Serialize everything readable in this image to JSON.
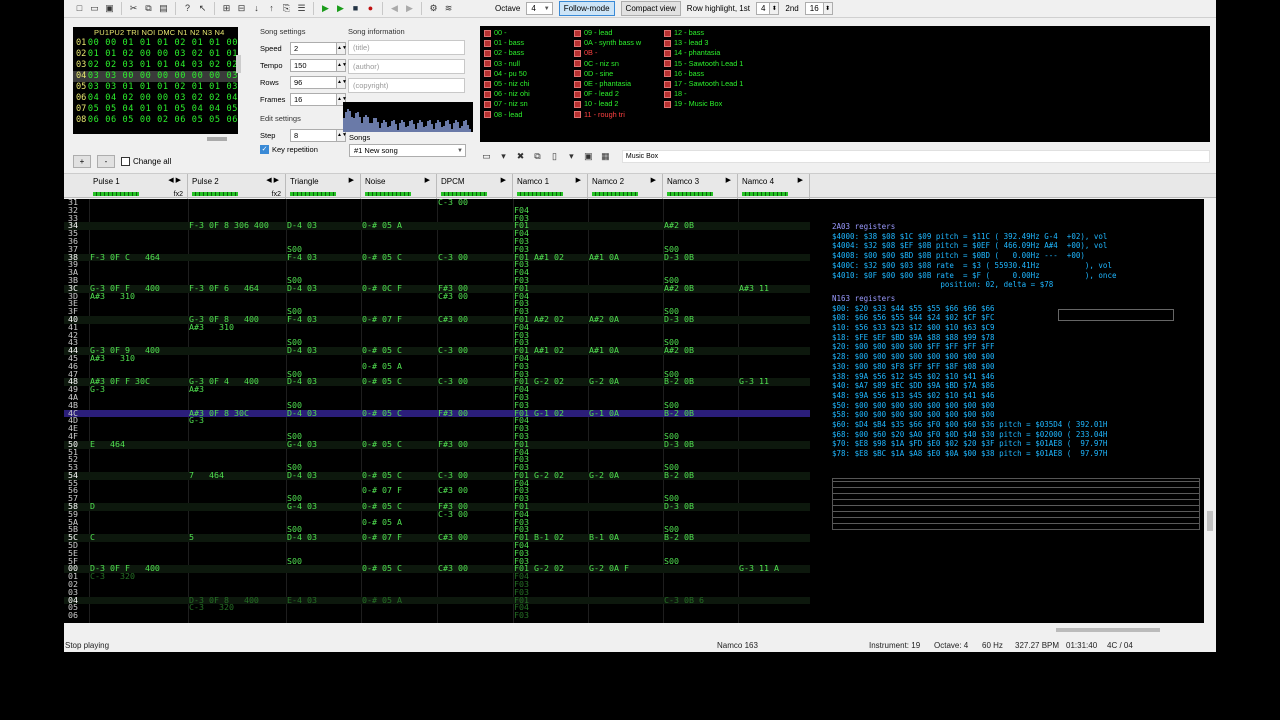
{
  "toolbar": {
    "octave_label": "Octave",
    "octave": "4",
    "follow": "Follow-mode",
    "compact": "Compact view",
    "rowhl_label": "Row highlight, 1st",
    "rowhl1": "4",
    "rowhl2_label": "2nd",
    "rowhl2": "16"
  },
  "frames": {
    "header": "PU1PU2 TRI NOI DMC N1  N2  N3  N4",
    "rows": [
      {
        "n": "01",
        "v": "00 00 01 01 01 02 01 01 00"
      },
      {
        "n": "02",
        "v": "01 01 02 00 00 03 02 01 01"
      },
      {
        "n": "03",
        "v": "02 02 03 01 01 04 03 02 02"
      },
      {
        "n": "04",
        "v": "03 03 00 00 00 00 00 00 03"
      },
      {
        "n": "05",
        "v": "03 03 01 01 01 02 01 01 03"
      },
      {
        "n": "06",
        "v": "04 04 02 00 00 03 02 02 04"
      },
      {
        "n": "07",
        "v": "05 05 04 01 01 05 04 04 05"
      },
      {
        "n": "08",
        "v": "06 06 05 00 02 06 05 05 06"
      }
    ]
  },
  "add_frame": "+",
  "remove_frame": "-",
  "change_all": "Change all",
  "song_settings": {
    "title": "Song settings",
    "speed_label": "Speed",
    "speed": "2",
    "tempo_label": "Tempo",
    "tempo": "150",
    "rows_label": "Rows",
    "rows": "96",
    "frames_label": "Frames",
    "frames": "16"
  },
  "edit_settings": {
    "title": "Edit settings",
    "step_label": "Step",
    "step": "8",
    "keyrep": "Key repetition"
  },
  "song_info": {
    "title": "Song information",
    "title_ph": "(title)",
    "author_ph": "(author)",
    "copyright_ph": "(copyright)"
  },
  "songs": {
    "label": "Songs",
    "selected": "#1 New song"
  },
  "instruments": {
    "col1": [
      "00 -",
      "01 - bass",
      "02 - bass",
      "03 - null",
      "04 - pu 50",
      "05 - niz chi",
      "06 - niz ohi",
      "07 - niz sn",
      "08 - lead"
    ],
    "col2": [
      "09 - lead",
      "0A - synth bass w",
      "0B -",
      "0C - niz sn",
      "0D - sine",
      "0E - phantasia",
      "0F - lead 2",
      "10 - lead 2",
      "11 - rough tri"
    ],
    "col3": [
      "12 - bass",
      "13 - lead 3",
      "14 - phantasia",
      "15 - Sawtooth Lead 1",
      "16 - bass",
      "17 - Sawtooth Lead 1",
      "18 -",
      "19 - Music Box"
    ],
    "name": "Music Box"
  },
  "channels": [
    {
      "name": "Pulse 1",
      "fx": "fx2"
    },
    {
      "name": "Pulse 2",
      "fx": "fx2"
    },
    {
      "name": "Triangle",
      "fx": ""
    },
    {
      "name": "Noise",
      "fx": ""
    },
    {
      "name": "DPCM",
      "fx": ""
    },
    {
      "name": "Namco 1",
      "fx": ""
    },
    {
      "name": "Namco 2",
      "fx": ""
    },
    {
      "name": "Namco 3",
      "fx": ""
    },
    {
      "name": "Namco 4",
      "fx": ""
    }
  ],
  "pattern": {
    "rows": [
      {
        "n": "31",
        "c": [
          "",
          "",
          "",
          "",
          "C-3 00",
          "",
          "",
          "",
          ""
        ]
      },
      {
        "n": "32",
        "c": [
          "",
          "",
          "",
          "",
          "",
          "F04",
          "",
          "",
          ""
        ]
      },
      {
        "n": "33",
        "c": [
          "",
          "",
          "",
          "",
          "",
          "F03",
          "",
          "",
          ""
        ]
      },
      {
        "n": "34",
        "c": [
          "",
          "F-3 0F 8 306 400",
          "D-4 03",
          "0-# 05 A",
          "",
          "F01",
          "",
          "A#2 0B",
          ""
        ]
      },
      {
        "n": "35",
        "c": [
          "",
          "",
          "",
          "",
          "",
          "F04",
          "",
          "",
          ""
        ]
      },
      {
        "n": "36",
        "c": [
          "",
          "",
          "",
          "",
          "",
          "F03",
          "",
          "",
          ""
        ]
      },
      {
        "n": "37",
        "c": [
          "",
          "",
          "S00",
          "",
          "",
          "F03",
          "",
          "S00",
          ""
        ]
      },
      {
        "n": "38",
        "c": [
          "F-3 0F C   464",
          "",
          "F-4 03",
          "0-# 05 C",
          "C-3 00",
          "F01 A#1 02",
          "A#1 0A",
          "D-3 0B",
          ""
        ]
      },
      {
        "n": "39",
        "c": [
          "",
          "",
          "",
          "",
          "",
          "F03",
          "",
          "",
          ""
        ]
      },
      {
        "n": "3A",
        "c": [
          "",
          "",
          "",
          "",
          "",
          "F04",
          "",
          "",
          ""
        ]
      },
      {
        "n": "3B",
        "c": [
          "",
          "",
          "S00",
          "",
          "",
          "F03",
          "",
          "S00",
          ""
        ]
      },
      {
        "n": "3C",
        "c": [
          "G-3 0F F   400",
          "F-3 0F 6   464",
          "D-4 03",
          "0-# 0C F",
          "F#3 00",
          "F01",
          "",
          "A#2 0B",
          "A#3 11"
        ]
      },
      {
        "n": "3D",
        "c": [
          "A#3   310",
          "",
          "",
          "",
          "C#3 00",
          "F04",
          "",
          "",
          ""
        ]
      },
      {
        "n": "3E",
        "c": [
          "",
          "",
          "",
          "",
          "",
          "F03",
          "",
          "",
          ""
        ]
      },
      {
        "n": "3F",
        "c": [
          "",
          "",
          "S00",
          "",
          "",
          "F03",
          "",
          "S00",
          ""
        ]
      },
      {
        "n": "40",
        "c": [
          "",
          "G-3 0F 8   400",
          "F-4 03",
          "0-# 07 F",
          "C#3 00",
          "F01 A#2 02",
          "A#2 0A",
          "D-3 0B",
          ""
        ]
      },
      {
        "n": "41",
        "c": [
          "",
          "A#3   310",
          "",
          "",
          "",
          "F04",
          "",
          "",
          ""
        ]
      },
      {
        "n": "42",
        "c": [
          "",
          "",
          "",
          "",
          "",
          "F03",
          "",
          "",
          ""
        ]
      },
      {
        "n": "43",
        "c": [
          "",
          "",
          "S00",
          "",
          "",
          "F03",
          "",
          "S00",
          ""
        ]
      },
      {
        "n": "44",
        "c": [
          "G-3 0F 9   400",
          "",
          "D-4 03",
          "0-# 05 C",
          "C-3 00",
          "F01 A#1 02",
          "A#1 0A",
          "A#2 0B",
          ""
        ]
      },
      {
        "n": "45",
        "c": [
          "A#3   310",
          "",
          "",
          "",
          "",
          "F04",
          "",
          "",
          ""
        ]
      },
      {
        "n": "46",
        "c": [
          "",
          "",
          "",
          "0-# 05 A",
          "",
          "F03",
          "",
          "",
          ""
        ]
      },
      {
        "n": "47",
        "c": [
          "",
          "",
          "S00",
          "",
          "",
          "F03",
          "",
          "S00",
          ""
        ]
      },
      {
        "n": "48",
        "c": [
          "A#3 0F F 30C",
          "G-3 0F 4   400",
          "D-4 03",
          "0-# 05 C",
          "C-3 00",
          "F01 G-2 02",
          "G-2 0A",
          "B-2 0B",
          "G-3 11"
        ]
      },
      {
        "n": "49",
        "c": [
          "G-3",
          "A#3",
          "",
          "",
          "",
          "F04",
          "",
          "",
          ""
        ]
      },
      {
        "n": "4A",
        "c": [
          "",
          "",
          "",
          "",
          "",
          "F03",
          "",
          "",
          ""
        ]
      },
      {
        "n": "4B",
        "c": [
          "",
          "",
          "S00",
          "",
          "",
          "F03",
          "",
          "S00",
          ""
        ]
      },
      {
        "n": "4C",
        "c": [
          "",
          "A#3 0F 8 30C",
          "D-4 03",
          "0-# 05 C",
          "F#3 00",
          "F01 G-1 02",
          "G-1 0A",
          "B-2 0B",
          ""
        ]
      },
      {
        "n": "4D",
        "c": [
          "",
          "G-3",
          "",
          "",
          "",
          "F04",
          "",
          "",
          ""
        ]
      },
      {
        "n": "4E",
        "c": [
          "",
          "",
          "",
          "",
          "",
          "F03",
          "",
          "",
          ""
        ]
      },
      {
        "n": "4F",
        "c": [
          "",
          "",
          "S00",
          "",
          "",
          "F03",
          "",
          "S00",
          ""
        ]
      },
      {
        "n": "50",
        "c": [
          "E   464",
          "",
          "G-4 03",
          "0-# 05 C",
          "F#3 00",
          "F01",
          "",
          "D-3 0B",
          ""
        ]
      },
      {
        "n": "51",
        "c": [
          "",
          "",
          "",
          "",
          "",
          "F04",
          "",
          "",
          ""
        ]
      },
      {
        "n": "52",
        "c": [
          "",
          "",
          "",
          "",
          "",
          "F03",
          "",
          "",
          ""
        ]
      },
      {
        "n": "53",
        "c": [
          "",
          "",
          "S00",
          "",
          "",
          "F03",
          "",
          "S00",
          ""
        ]
      },
      {
        "n": "54",
        "c": [
          "",
          "7   464",
          "D-4 03",
          "0-# 05 C",
          "C-3 00",
          "F01 G-2 02",
          "G-2 0A",
          "B-2 0B",
          ""
        ]
      },
      {
        "n": "55",
        "c": [
          "",
          "",
          "",
          "",
          "",
          "F04",
          "",
          "",
          ""
        ]
      },
      {
        "n": "56",
        "c": [
          "",
          "",
          "",
          "0-# 07 F",
          "C#3 00",
          "F03",
          "",
          "",
          ""
        ]
      },
      {
        "n": "57",
        "c": [
          "",
          "",
          "S00",
          "",
          "",
          "F03",
          "",
          "S00",
          ""
        ]
      },
      {
        "n": "58",
        "c": [
          "D",
          "",
          "G-4 03",
          "0-# 05 C",
          "F#3 00",
          "F01",
          "",
          "D-3 0B",
          ""
        ]
      },
      {
        "n": "59",
        "c": [
          "",
          "",
          "",
          "",
          "C-3 00",
          "F04",
          "",
          "",
          ""
        ]
      },
      {
        "n": "5A",
        "c": [
          "",
          "",
          "",
          "0-# 05 A",
          "",
          "F03",
          "",
          "",
          ""
        ]
      },
      {
        "n": "5B",
        "c": [
          "",
          "",
          "S00",
          "",
          "",
          "F03",
          "",
          "S00",
          ""
        ]
      },
      {
        "n": "5C",
        "c": [
          "C",
          "5",
          "D-4 03",
          "0-# 07 F",
          "C#3 00",
          "F01 B-1 02",
          "B-1 0A",
          "B-2 0B",
          ""
        ]
      },
      {
        "n": "5D",
        "c": [
          "",
          "",
          "",
          "",
          "",
          "F04",
          "",
          "",
          ""
        ]
      },
      {
        "n": "5E",
        "c": [
          "",
          "",
          "",
          "",
          "",
          "F03",
          "",
          "",
          ""
        ]
      },
      {
        "n": "5F",
        "c": [
          "",
          "",
          "S00",
          "",
          "",
          "F03",
          "",
          "S00",
          ""
        ]
      },
      {
        "n": "00",
        "c": [
          "D-3 0F F   400",
          "",
          "",
          "0-# 05 C",
          "C#3 00",
          "F01 G-2 02",
          "G-2 0A F",
          "",
          "G-3 11 A"
        ]
      },
      {
        "n": "01",
        "c": [
          "C-3   320",
          "",
          "",
          "",
          "",
          "F04",
          "",
          "",
          ""
        ]
      },
      {
        "n": "02",
        "c": [
          "",
          "",
          "",
          "",
          "",
          "F03",
          "",
          "",
          ""
        ]
      },
      {
        "n": "03",
        "c": [
          "",
          "",
          "",
          "",
          "",
          "F03",
          "",
          "",
          ""
        ]
      },
      {
        "n": "04",
        "c": [
          "",
          "D-3 0F 8   400",
          "E-4 03",
          "0-# 05 A",
          "",
          "F01",
          "",
          "C-3 0B 6",
          ""
        ]
      },
      {
        "n": "05",
        "c": [
          "",
          "C-3   320",
          "",
          "",
          "",
          "F04",
          "",
          "",
          ""
        ]
      },
      {
        "n": "06",
        "c": [
          "",
          "",
          "",
          "",
          "",
          "F03",
          "",
          "",
          ""
        ]
      }
    ]
  },
  "regs": {
    "h1": "2A03 registers",
    "a": [
      "$4000: $38 $08 $1C $09 pitch = $11C ( 392.49Hz G-4  +02), vol",
      "$4004: $32 $08 $EF $0B pitch = $0EF ( 466.09Hz A#4  +00), vol",
      "$4008: $00 $00 $BD $0B pitch = $0BD (   0.00Hz ---  +00)",
      "$400C: $32 $00 $03 $08 rate  = $3 ( 55930.41Hz          ), vol",
      "$4010: $0F $00 $00 $0B rate  = $F (     0.00Hz          ), once",
      "                        position: 02, delta = $78"
    ],
    "h2": "N163 registers",
    "b": [
      "$00: $20 $33 $44 $55 $55 $66 $66 $66",
      "$08: $66 $56 $55 $44 $24 $02 $CF $FC",
      "$10: $56 $33 $23 $12 $00 $10 $63 $C9",
      "$18: $FE $EF $BD $9A $88 $88 $99 $78",
      "$20: $00 $00 $00 $00 $FF $FF $FF $FF",
      "$28: $00 $00 $00 $00 $00 $00 $00 $00",
      "$30: $00 $80 $F8 $FF $FF $8F $08 $00",
      "$38: $9A $56 $12 $45 $02 $10 $41 $46",
      "$40: $A7 $89 $EC $DD $9A $BD $7A $86",
      "$48: $9A $56 $13 $45 $02 $10 $41 $46",
      "$50: $00 $00 $00 $00 $00 $00 $00 $00",
      "$58: $00 $00 $00 $00 $00 $00 $00 $00",
      "$60: $D4 $B4 $35 $66 $F0 $00 $60 $36 pitch = $035D4 ( 392.01H",
      "$68: $00 $60 $20 $A0 $F0 $0D $40 $30 pitch = $02000 ( 233.04H",
      "$70: $E8 $98 $1A $FD $E0 $02 $20 $3F pitch = $01AE8 (  97.97H",
      "$78: $E8 $BC $1A $A8 $E0 $0A $00 $38 pitch = $01AE8 (  97.97H"
    ]
  },
  "status": {
    "left": "Stop playing",
    "chip": "Namco 163",
    "instrument": "Instrument: 19",
    "octave": "Octave: 4",
    "rate": "60 Hz",
    "bpm": "327.27 BPM",
    "time": "01:31:40",
    "pos": "4C / 04"
  }
}
